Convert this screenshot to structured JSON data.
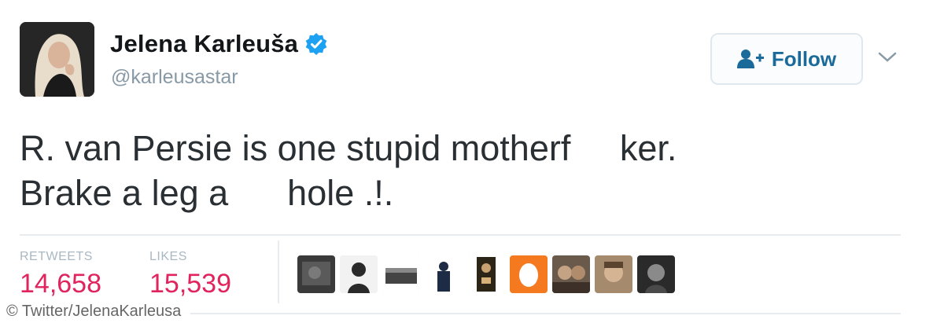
{
  "user": {
    "display_name": "Jelena Karleuša",
    "handle": "@karleusastar",
    "verified": true
  },
  "follow_button": {
    "label": "Follow",
    "icon": "add-person-icon"
  },
  "tweet": {
    "line1": "R. van Persie is one stupid motherf     ker.",
    "line2": "Brake a leg a      hole .!."
  },
  "stats": {
    "retweets_label": "RETWEETS",
    "retweets_value": "14,658",
    "likes_label": "LIKES",
    "likes_value": "15,539"
  },
  "credit": "© Twitter/JelenaKarleusa",
  "colors": {
    "verified": "#1da1f2",
    "follow_text": "#1b6b9a",
    "stat_value": "#e0245e",
    "handle": "#8899a6",
    "stat_label": "#aab8c2"
  }
}
